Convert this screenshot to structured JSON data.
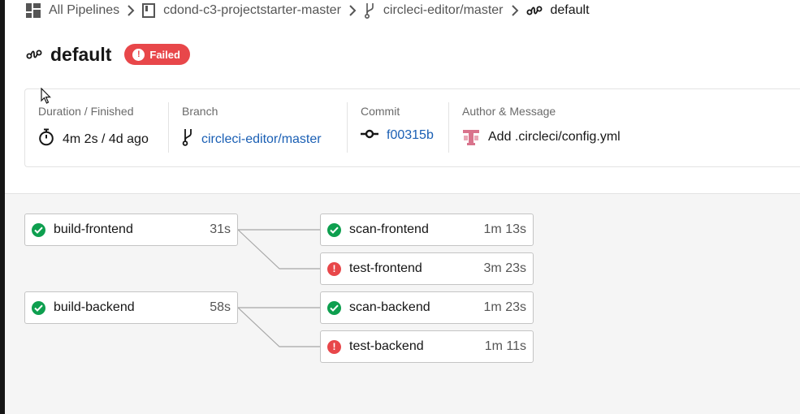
{
  "breadcrumb": {
    "items": [
      {
        "label": "All Pipelines",
        "icon": "dashboard-icon"
      },
      {
        "label": "cdond-c3-projectstarter-master",
        "icon": "repo-icon"
      },
      {
        "label": "circleci-editor/master",
        "icon": "branch-icon"
      },
      {
        "label": "default",
        "icon": "workflow-icon"
      }
    ]
  },
  "header": {
    "title": "default",
    "status": "Failed",
    "status_color": "#e8474a"
  },
  "info": {
    "duration_label": "Duration / Finished",
    "duration_value": "4m 2s / 4d ago",
    "branch_label": "Branch",
    "branch_value": "circleci-editor/master",
    "commit_label": "Commit",
    "commit_value": "f00315b",
    "author_label": "Author & Message",
    "author_message": "Add .circleci/config.yml",
    "link_color": "#1a5fb4"
  },
  "jobs": {
    "build_frontend": {
      "name": "build-frontend",
      "duration": "31s",
      "status": "success"
    },
    "scan_frontend": {
      "name": "scan-frontend",
      "duration": "1m 13s",
      "status": "success"
    },
    "test_frontend": {
      "name": "test-frontend",
      "duration": "3m 23s",
      "status": "failed"
    },
    "build_backend": {
      "name": "build-backend",
      "duration": "58s",
      "status": "success"
    },
    "scan_backend": {
      "name": "scan-backend",
      "duration": "1m 23s",
      "status": "success"
    },
    "test_backend": {
      "name": "test-backend",
      "duration": "1m 11s",
      "status": "failed"
    }
  },
  "colors": {
    "success": "#0e9f4f",
    "failed": "#e8474a"
  }
}
